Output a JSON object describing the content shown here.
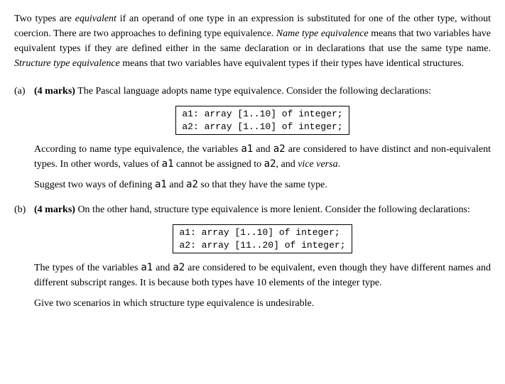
{
  "intro": {
    "text_before_equiv": "Two types are ",
    "equiv": "equivalent",
    "text_after_equiv": " if an operand of one type in an expression is substituted for one of the other type, without coercion. There are two approaches to defining type equivalence. ",
    "name_equiv": "Name type equivalence",
    "text_after_name": " means that two variables have equivalent types if they are defined either in the same declaration or in declarations that use the same type name. ",
    "struct_equiv": "Structure type equivalence",
    "text_after_struct": " means that two variables have equivalent types if their types have identical structures."
  },
  "qa": {
    "label": "(a) ",
    "marks": "(4 marks)",
    "intro": " The Pascal language adopts name type equivalence.  Consider the following declarations:",
    "code": "a1: array [1..10] of integer;\na2: array [1..10] of integer;",
    "body_before_mono1": "According to name type equivalence, the variables ",
    "mono1": "a1",
    "body_mid1": " and ",
    "mono2": "a2",
    "body_mid2": " are considered to have distinct and non-equivalent types. In other words, values of ",
    "mono3": "a1",
    "body_mid3": " cannot be assigned to ",
    "mono4": "a2",
    "body_mid4": ", and ",
    "vice": "vice versa",
    "body_end": ".",
    "instruction_before": "Suggest two ways of defining ",
    "instr_mono1": "a1",
    "instruction_mid": " and ",
    "instr_mono2": "a2",
    "instruction_after": " so that they have the same type."
  },
  "qb": {
    "label": "(b) ",
    "marks": "(4 marks)",
    "intro": " On the other hand, structure type equivalence is more lenient.  Consider the following declarations:",
    "code": "a1: array [1..10] of integer;\na2: array [11..20] of integer;",
    "body_before": "The types of the variables ",
    "mono1": "a1",
    "body_mid1": " and ",
    "mono2": "a2",
    "body_after": " are considered to be equivalent, even though they have different names and different subscript ranges. It is because both types have 10 elements of the integer type.",
    "instruction": "Give two scenarios in which structure type equivalence is undesirable."
  }
}
